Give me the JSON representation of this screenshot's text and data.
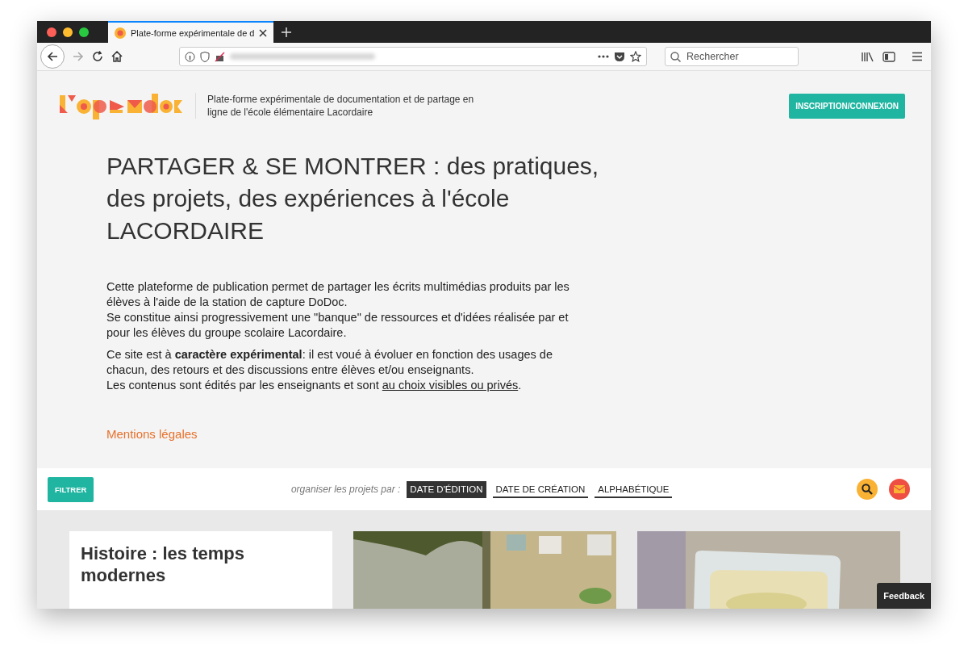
{
  "browser": {
    "tab_title": "Plate-forme expérimentale de d",
    "search": {
      "placeholder": "Rechercher"
    }
  },
  "header": {
    "tagline": "Plate-forme expérimentale de documentation et de partage en ligne de l'école élémentaire Lacordaire",
    "login_button": "INSCRIPTION/CONNEXION"
  },
  "hero": {
    "title": "PARTAGER & SE MONTRER : des pratiques, des projets, des expériences à l'école LACORDAIRE",
    "blocks": [
      [
        {
          "text": "Cette plateforme de publication permet de partager les écrits multimédias produits par les élèves à l'aide de la station de capture DoDoc."
        },
        {
          "text": "Se constitue ainsi progressivement une \"banque\" de ressources et d'idées réalisée par et pour les élèves du groupe scolaire Lacordaire."
        }
      ],
      [
        {
          "text": "Ce site est à **caractère expérimental**: il est voué à évoluer en fonction des usages de chacun, des retours et des discussions entre élèves et/ou enseignants."
        },
        {
          "text": "Les contenus sont édités par les enseignants et sont ",
          "link": "au choix visibles ou privés",
          "after": "."
        }
      ]
    ],
    "legal_link": "Mentions légales"
  },
  "toolbar": {
    "filter_button": "FILTRER",
    "sort_label": "organiser les projets par :",
    "sort_options": [
      {
        "label": "DATE D'ÉDITION",
        "selected": true
      },
      {
        "label": "DATE DE CRÉATION",
        "selected": false
      },
      {
        "label": "ALPHABÉTIQUE",
        "selected": false
      }
    ]
  },
  "cards": [
    {
      "kind": "text",
      "title": "Histoire : les temps modernes"
    },
    {
      "kind": "picture"
    },
    {
      "kind": "picture"
    }
  ],
  "feedback_button": "Feedback"
}
